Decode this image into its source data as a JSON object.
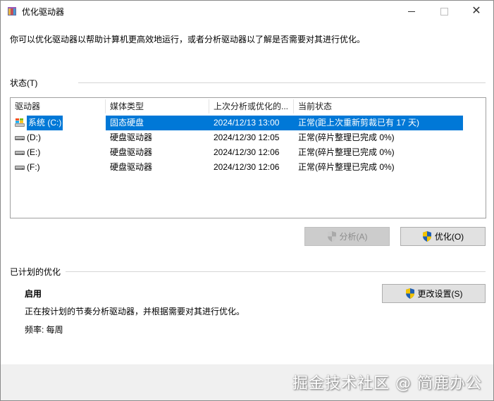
{
  "window": {
    "title": "优化驱动器"
  },
  "description": "你可以优化驱动器以帮助计算机更高效地运行，或者分析驱动器以了解是否需要对其进行优化。",
  "status_section": {
    "label": "状态(T)",
    "columns": [
      "驱动器",
      "媒体类型",
      "上次分析或优化的...",
      "当前状态"
    ],
    "rows": [
      {
        "drive": "系统 (C:)",
        "media": "固态硬盘",
        "last": "2024/12/13 13:00",
        "status": "正常(距上次重新剪裁已有 17 天)",
        "icon": "windows-drive-icon",
        "selected": true
      },
      {
        "drive": "(D:)",
        "media": "硬盘驱动器",
        "last": "2024/12/30 12:05",
        "status": "正常(碎片整理已完成 0%)",
        "icon": "hard-drive-icon",
        "selected": false
      },
      {
        "drive": "(E:)",
        "media": "硬盘驱动器",
        "last": "2024/12/30 12:06",
        "status": "正常(碎片整理已完成 0%)",
        "icon": "hard-drive-icon",
        "selected": false
      },
      {
        "drive": "(F:)",
        "media": "硬盘驱动器",
        "last": "2024/12/30 12:06",
        "status": "正常(碎片整理已完成 0%)",
        "icon": "hard-drive-icon",
        "selected": false
      }
    ],
    "analyze_button": "分析(A)",
    "optimize_button": "优化(O)"
  },
  "schedule_section": {
    "label": "已计划的优化",
    "state": "启用",
    "text": "正在按计划的节奏分析驱动器，并根据需要对其进行优化。",
    "frequency": "频率: 每周",
    "change_button": "更改设置(S)"
  },
  "watermark": "掘金技术社区 @ 简鹿办公",
  "colors": {
    "selection": "#0078d7",
    "button_bg": "#e1e1e1",
    "footer_bg": "#f0f0f0"
  }
}
